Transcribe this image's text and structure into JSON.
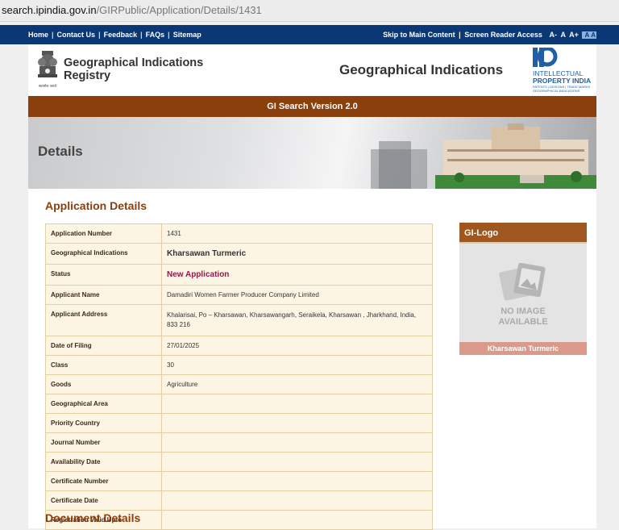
{
  "browser": {
    "url_host": "search.ipindia.gov.in",
    "url_path": "/GIRPublic/Application/Details/1431"
  },
  "topnav": {
    "left_links": [
      "Home",
      "Contact Us",
      "Feedback",
      "FAQs",
      "Sitemap"
    ],
    "skip_link": "Skip to Main Content",
    "screen_reader": "Screen Reader Access",
    "font_small": "A-",
    "font_normal": "A",
    "font_large": "A+",
    "contrast_a": "A",
    "contrast_b": "A"
  },
  "header": {
    "registry_line1": "Geographical Indications",
    "registry_line2": "Registry",
    "emblem_caption": "सत्यमेव जयते",
    "center_title": "Geographical Indications",
    "ip_logo_line1": "INTELLECTUAL",
    "ip_logo_line2": "PROPERTY INDIA",
    "ip_logo_line3": "PATENTS | DESIGNS | TRADE MARKS",
    "ip_logo_line4": "GEOGRAPHICAL INDICATIONS"
  },
  "search_bar": {
    "title": "GI Search Version 2.0"
  },
  "banner": {
    "title": "Details"
  },
  "section_title": "Application Details",
  "details": [
    {
      "label": "Application Number",
      "value": "1431"
    },
    {
      "label": "Geographical Indications",
      "value": "Kharsawan Turmeric"
    },
    {
      "label": "Status",
      "value": "New Application"
    },
    {
      "label": "Applicant Name",
      "value": "Damadiri Women Farmer Producer Company Limited"
    },
    {
      "label": "Applicant Address",
      "value": "Khalarisai, Po – Kharsawan, Kharsawangarh, Seraikela, Kharsawan , Jharkhand, India, 833 216"
    },
    {
      "label": "Date of Filing",
      "value": "27/01/2025"
    },
    {
      "label": "Class",
      "value": "30"
    },
    {
      "label": "Goods",
      "value": "Agriculture"
    },
    {
      "label": "Geographical Area",
      "value": ""
    },
    {
      "label": "Priority Country",
      "value": ""
    },
    {
      "label": "Journal Number",
      "value": ""
    },
    {
      "label": "Availability Date",
      "value": ""
    },
    {
      "label": "Certificate Number",
      "value": ""
    },
    {
      "label": "Certificate Date",
      "value": ""
    },
    {
      "label": "Registration Valid Upto",
      "value": ""
    }
  ],
  "gi_logo": {
    "heading": "GI-Logo",
    "no_image_line1": "NO IMAGE",
    "no_image_line2": "AVAILABLE",
    "caption": "Kharsawan Turmeric"
  },
  "document_section_title": "Document Details",
  "colors": {
    "nav_blue": "#0b3774",
    "brand_brown": "#8a3f0d",
    "status_magenta": "#8e1b4a",
    "table_bg": "#fdf5e4"
  }
}
